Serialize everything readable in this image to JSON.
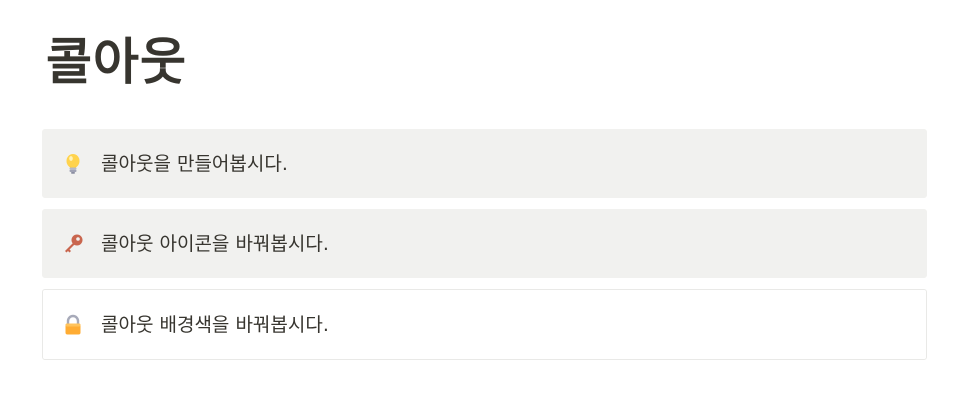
{
  "page": {
    "title": "콜아웃"
  },
  "callouts": [
    {
      "icon": "lightbulb-icon",
      "text": "콜아웃을 만들어봅시다.",
      "background": "#f1f1ef"
    },
    {
      "icon": "key-icon",
      "text": "콜아웃 아이콘을 바꿔봅시다.",
      "background": "#f1f1ef"
    },
    {
      "icon": "lock-icon",
      "text": "콜아웃 배경색을 바꿔봅시다.",
      "background": "#ffffff"
    }
  ]
}
